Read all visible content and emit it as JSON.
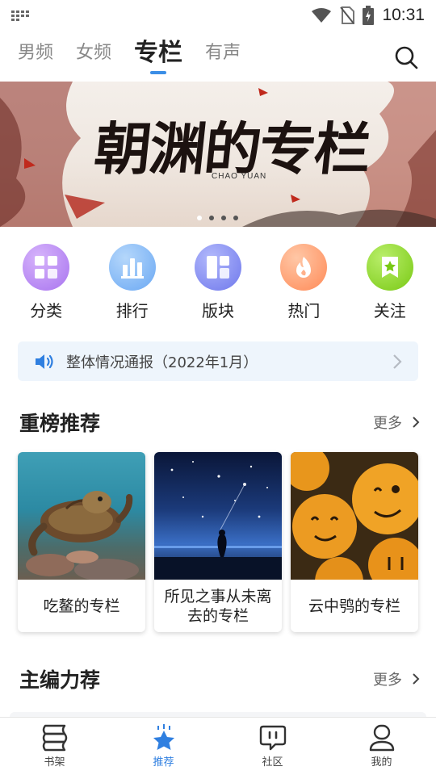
{
  "status_bar": {
    "time": "10:31",
    "icons": [
      "keyboard-icon",
      "wifi-icon",
      "no-sim-icon",
      "battery-charging-icon"
    ]
  },
  "top_tabs": {
    "items": [
      {
        "label": "男频",
        "active": false
      },
      {
        "label": "女频",
        "active": false
      },
      {
        "label": "专栏",
        "active": true
      },
      {
        "label": "有声",
        "active": false
      }
    ],
    "search_icon": "search-icon",
    "accent_color": "#3b8ee6"
  },
  "banner": {
    "title": "朝渊的专栏",
    "subtitle": "CHAO YUAN",
    "page_count": 4,
    "current_page": 1
  },
  "quick_menu": [
    {
      "label": "分类",
      "icon": "grid-icon",
      "color": "#b587f0"
    },
    {
      "label": "排行",
      "icon": "bar-chart-icon",
      "color": "#7fb6f6"
    },
    {
      "label": "版块",
      "icon": "layout-blocks-icon",
      "color": "#7d88f2"
    },
    {
      "label": "热门",
      "icon": "flame-icon",
      "color": "#ff9a6b"
    },
    {
      "label": "关注",
      "icon": "star-bookmark-icon",
      "color": "#86d220"
    }
  ],
  "notice": {
    "text": "整体情况通报（2022年1月）",
    "icon": "speaker-icon",
    "icon_color": "#2f7fe0"
  },
  "featured": {
    "title": "重榜推荐",
    "more_label": "更多",
    "cards": [
      {
        "name": "吃鳌的专栏",
        "image": "sea-turtle-photo"
      },
      {
        "name": "所见之事从未离去的专栏",
        "image": "starry-night-photo"
      },
      {
        "name": "云中鸮的专栏",
        "image": "smiley-oranges-photo"
      }
    ]
  },
  "editor_picks": {
    "title": "主编力荐",
    "more_label": "更多"
  },
  "bottom_nav": [
    {
      "label": "书架",
      "icon": "bookshelf-icon",
      "active": false
    },
    {
      "label": "推荐",
      "icon": "star-icon",
      "active": true
    },
    {
      "label": "社区",
      "icon": "chat-bubble-icon",
      "active": false
    },
    {
      "label": "我的",
      "icon": "profile-icon",
      "active": false
    }
  ]
}
